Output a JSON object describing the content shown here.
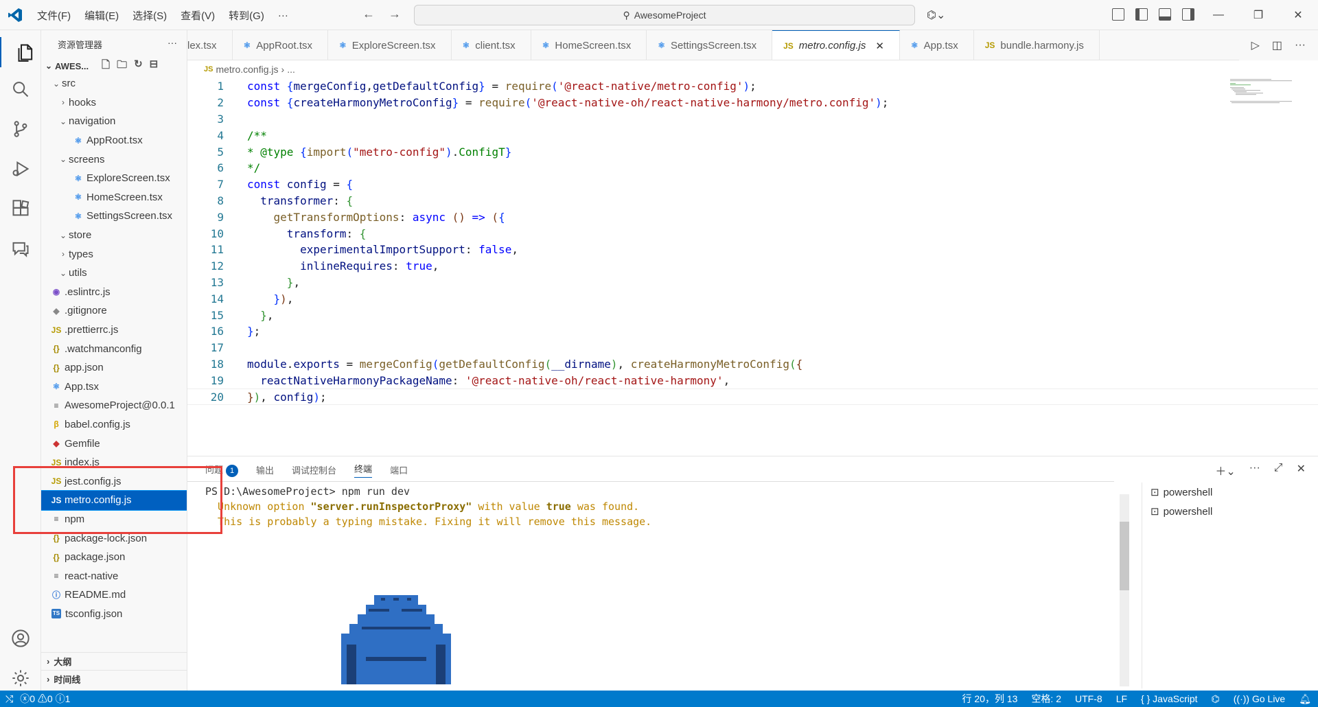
{
  "window": {
    "menu": [
      "文件(F)",
      "编辑(E)",
      "选择(S)",
      "查看(V)",
      "转到(G)",
      "···"
    ],
    "search": "AwesomeProject"
  },
  "sidebar": {
    "title": "资源管理器",
    "more": "···",
    "project": "AWES...",
    "items": [
      {
        "label": "src",
        "chev": "⌄",
        "indent": 1,
        "icon": "",
        "cls": ""
      },
      {
        "label": "hooks",
        "chev": "›",
        "indent": 2,
        "icon": "",
        "cls": ""
      },
      {
        "label": "navigation",
        "chev": "⌄",
        "indent": 2,
        "icon": "",
        "cls": ""
      },
      {
        "label": "AppRoot.tsx",
        "chev": "",
        "indent": 3,
        "icon": "⚛",
        "cls": "react"
      },
      {
        "label": "screens",
        "chev": "⌄",
        "indent": 2,
        "icon": "",
        "cls": ""
      },
      {
        "label": "ExploreScreen.tsx",
        "chev": "",
        "indent": 3,
        "icon": "⚛",
        "cls": "react"
      },
      {
        "label": "HomeScreen.tsx",
        "chev": "",
        "indent": 3,
        "icon": "⚛",
        "cls": "react"
      },
      {
        "label": "SettingsScreen.tsx",
        "chev": "",
        "indent": 3,
        "icon": "⚛",
        "cls": "react"
      },
      {
        "label": "store",
        "chev": "⌄",
        "indent": 2,
        "icon": "",
        "cls": ""
      },
      {
        "label": "types",
        "chev": "›",
        "indent": 2,
        "icon": "",
        "cls": ""
      },
      {
        "label": "utils",
        "chev": "⌄",
        "indent": 2,
        "icon": "",
        "cls": ""
      },
      {
        "label": ".eslintrc.js",
        "chev": "",
        "indent": 0,
        "icon": "◉",
        "cls": "eslint"
      },
      {
        "label": ".gitignore",
        "chev": "",
        "indent": 0,
        "icon": "◆",
        "cls": "git"
      },
      {
        "label": ".prettierrc.js",
        "chev": "",
        "indent": 0,
        "icon": "JS",
        "cls": "js"
      },
      {
        "label": ".watchmanconfig",
        "chev": "",
        "indent": 0,
        "icon": "{}",
        "cls": "json"
      },
      {
        "label": "app.json",
        "chev": "",
        "indent": 0,
        "icon": "{}",
        "cls": "json"
      },
      {
        "label": "App.tsx",
        "chev": "",
        "indent": 0,
        "icon": "⚛",
        "cls": "react"
      },
      {
        "label": "AwesomeProject@0.0.1",
        "chev": "",
        "indent": 0,
        "icon": "≡",
        "cls": "text"
      },
      {
        "label": "babel.config.js",
        "chev": "",
        "indent": 0,
        "icon": "β",
        "cls": "babel"
      },
      {
        "label": "Gemfile",
        "chev": "",
        "indent": 0,
        "icon": "◆",
        "cls": "gem"
      },
      {
        "label": "index.js",
        "chev": "",
        "indent": 0,
        "icon": "JS",
        "cls": "js"
      },
      {
        "label": "jest.config.js",
        "chev": "",
        "indent": 0,
        "icon": "JS",
        "cls": "js"
      },
      {
        "label": "metro.config.js",
        "chev": "",
        "indent": 0,
        "icon": "JS",
        "cls": "js",
        "selected": true
      },
      {
        "label": "npm",
        "chev": "",
        "indent": 0,
        "icon": "≡",
        "cls": "text"
      },
      {
        "label": "package-lock.json",
        "chev": "",
        "indent": 0,
        "icon": "{}",
        "cls": "json"
      },
      {
        "label": "package.json",
        "chev": "",
        "indent": 0,
        "icon": "{}",
        "cls": "json"
      },
      {
        "label": "react-native",
        "chev": "",
        "indent": 0,
        "icon": "≡",
        "cls": "text"
      },
      {
        "label": "README.md",
        "chev": "",
        "indent": 0,
        "icon": "ⓘ",
        "cls": "info"
      },
      {
        "label": "tsconfig.json",
        "chev": "",
        "indent": 0,
        "icon": "TS",
        "cls": "ts"
      }
    ],
    "outline": "大纲",
    "timeline": "时间线"
  },
  "tabs": [
    {
      "label": "lex.tsx",
      "icon": "",
      "active": false
    },
    {
      "label": "AppRoot.tsx",
      "icon": "⚛",
      "active": false
    },
    {
      "label": "ExploreScreen.tsx",
      "icon": "⚛",
      "active": false
    },
    {
      "label": "client.tsx",
      "icon": "⚛",
      "active": false
    },
    {
      "label": "HomeScreen.tsx",
      "icon": "⚛",
      "active": false
    },
    {
      "label": "SettingsScreen.tsx",
      "icon": "⚛",
      "active": false
    },
    {
      "label": "metro.config.js",
      "icon": "JS",
      "active": true
    },
    {
      "label": "App.tsx",
      "icon": "⚛",
      "active": false
    },
    {
      "label": "bundle.harmony.js",
      "icon": "JS",
      "active": false
    }
  ],
  "breadcrumb": {
    "icon": "JS",
    "file": "metro.config.js",
    "sep": "›",
    "rest": "..."
  },
  "editor": {
    "lines": [
      [
        [
          "kw",
          "const "
        ],
        [
          "b1",
          "{"
        ],
        [
          "prop",
          "mergeConfig"
        ],
        [
          "",
          ","
        ],
        [
          "prop",
          "getDefaultConfig"
        ],
        [
          "b1",
          "}"
        ],
        [
          "",
          " = "
        ],
        [
          "fn",
          "require"
        ],
        [
          "b1",
          "("
        ],
        [
          "str",
          "'@react-native/metro-config'"
        ],
        [
          "b1",
          ")"
        ],
        [
          "",
          ";"
        ]
      ],
      [
        [
          "kw",
          "const "
        ],
        [
          "b1",
          "{"
        ],
        [
          "prop",
          "createHarmonyMetroConfig"
        ],
        [
          "b1",
          "}"
        ],
        [
          "",
          " = "
        ],
        [
          "fn",
          "require"
        ],
        [
          "b1",
          "("
        ],
        [
          "str",
          "'@react-native-oh/react-native-harmony/metro.config'"
        ],
        [
          "b1",
          ")"
        ],
        [
          "",
          ";"
        ]
      ],
      [],
      [
        [
          "cmt",
          "/**"
        ]
      ],
      [
        [
          "cmt",
          "* @type "
        ],
        [
          "b1",
          "{"
        ],
        [
          "fn",
          "import"
        ],
        [
          "b1",
          "("
        ],
        [
          "str",
          "\"metro-config\""
        ],
        [
          "b1",
          ")"
        ],
        [
          "",
          "."
        ],
        [
          "cmt",
          "ConfigT"
        ],
        [
          "b1",
          "}"
        ]
      ],
      [
        [
          "cmt",
          "*/"
        ]
      ],
      [
        [
          "kw",
          "const "
        ],
        [
          "prop",
          "config"
        ],
        [
          "",
          " = "
        ],
        [
          "b1",
          "{"
        ]
      ],
      [
        [
          "",
          "  "
        ],
        [
          "prop",
          "transformer"
        ],
        [
          "",
          ": "
        ],
        [
          "b2",
          "{"
        ]
      ],
      [
        [
          "",
          "    "
        ],
        [
          "fn",
          "getTransformOptions"
        ],
        [
          "",
          ": "
        ],
        [
          "kw",
          "async "
        ],
        [
          "b3",
          "()"
        ],
        [
          "kw",
          " => "
        ],
        [
          "b3",
          "("
        ],
        [
          "b1",
          "{"
        ]
      ],
      [
        [
          "",
          "      "
        ],
        [
          "prop",
          "transform"
        ],
        [
          "",
          ": "
        ],
        [
          "b2",
          "{"
        ]
      ],
      [
        [
          "",
          "        "
        ],
        [
          "prop",
          "experimentalImportSupport"
        ],
        [
          "",
          ": "
        ],
        [
          "kw",
          "false"
        ],
        [
          "",
          ","
        ]
      ],
      [
        [
          "",
          "        "
        ],
        [
          "prop",
          "inlineRequires"
        ],
        [
          "",
          ": "
        ],
        [
          "kw",
          "true"
        ],
        [
          "",
          ","
        ]
      ],
      [
        [
          "",
          "      "
        ],
        [
          "b2",
          "}"
        ],
        [
          "",
          ","
        ]
      ],
      [
        [
          "",
          "    "
        ],
        [
          "b1",
          "}"
        ],
        [
          "b3",
          ")"
        ],
        [
          "",
          ","
        ]
      ],
      [
        [
          "",
          "  "
        ],
        [
          "b2",
          "}"
        ],
        [
          "",
          ","
        ]
      ],
      [
        [
          "b1",
          "}"
        ],
        [
          "",
          ";"
        ]
      ],
      [],
      [
        [
          "prop",
          "module"
        ],
        [
          "",
          "."
        ],
        [
          "prop",
          "exports"
        ],
        [
          "",
          " = "
        ],
        [
          "fn",
          "mergeConfig"
        ],
        [
          "b1",
          "("
        ],
        [
          "fn",
          "getDefaultConfig"
        ],
        [
          "b2",
          "("
        ],
        [
          "prop",
          "__dirname"
        ],
        [
          "b2",
          ")"
        ],
        [
          "",
          ", "
        ],
        [
          "fn",
          "createHarmonyMetroConfig"
        ],
        [
          "b2",
          "("
        ],
        [
          "b3",
          "{"
        ]
      ],
      [
        [
          "",
          "  "
        ],
        [
          "prop",
          "reactNativeHarmonyPackageName"
        ],
        [
          "",
          ": "
        ],
        [
          "str",
          "'@react-native-oh/react-native-harmony'"
        ],
        [
          "",
          ","
        ]
      ],
      [
        [
          "b3",
          "}"
        ],
        [
          "b2",
          ")"
        ],
        [
          "",
          ", "
        ],
        [
          "prop",
          "config"
        ],
        [
          "b1",
          ")"
        ],
        [
          "",
          ";"
        ]
      ]
    ]
  },
  "panel": {
    "tabs": [
      "问题",
      "输出",
      "调试控制台",
      "终端",
      "端口"
    ],
    "active_tab": "终端",
    "problems_count": "1",
    "terminal": {
      "prompt": "PS D:\\AwesomeProject> ",
      "command": "npm run dev",
      "warn1_pre": "  Unknown option ",
      "warn1_opt": "\"server.runInspectorProxy\"",
      "warn1_mid": " with value ",
      "warn1_val": "true",
      "warn1_post": " was found.",
      "warn2": "  This is probably a typing mistake. Fixing it will remove this message."
    },
    "instances": [
      "powershell",
      "powershell"
    ]
  },
  "status": {
    "errors": "0",
    "warnings": "0",
    "info": "1",
    "position": "行 20，列 13",
    "spaces": "空格: 2",
    "encoding": "UTF-8",
    "eol": "LF",
    "language": "JavaScript",
    "golive": "Go Live"
  }
}
